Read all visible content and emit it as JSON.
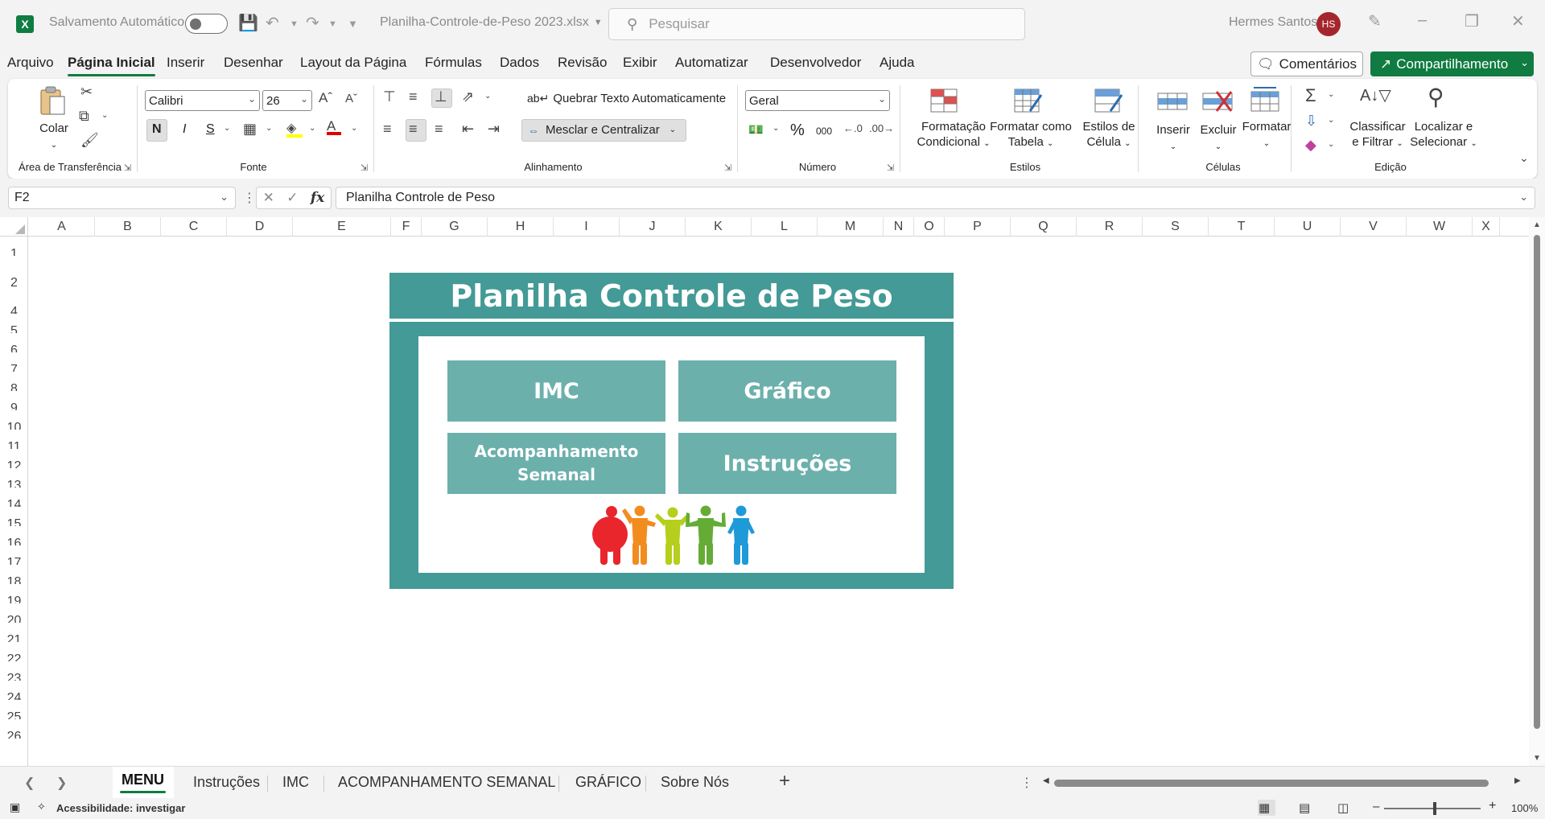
{
  "titlebar": {
    "autosave_label": "Salvamento Automático",
    "filename": "Planilha-Controle-de-Peso 2023.xlsx",
    "search_placeholder": "Pesquisar",
    "user_name": "Hermes Santos",
    "user_initials": "HS"
  },
  "menu": {
    "tabs": [
      "Arquivo",
      "Página Inicial",
      "Inserir",
      "Desenhar",
      "Layout da Página",
      "Fórmulas",
      "Dados",
      "Revisão",
      "Exibir",
      "Automatizar",
      "Desenvolvedor",
      "Ajuda"
    ],
    "active": "Página Inicial",
    "comments_label": "Comentários",
    "share_label": "Compartilhamento"
  },
  "ribbon": {
    "clipboard": {
      "paste_label": "Colar",
      "group_label": "Área de Transferência"
    },
    "font": {
      "font_name": "Calibri",
      "font_size": "26",
      "bold": "N",
      "italic": "I",
      "underline": "S",
      "group_label": "Fonte"
    },
    "alignment": {
      "wrap_label": "Quebrar Texto Automaticamente",
      "merge_label": "Mesclar e Centralizar",
      "group_label": "Alinhamento"
    },
    "number": {
      "format": "Geral",
      "percent": "%",
      "thousands": "000",
      "group_label": "Número"
    },
    "styles": {
      "cond_format_l1": "Formatação",
      "cond_format_l2": "Condicional",
      "table_l1": "Formatar como",
      "table_l2": "Tabela",
      "cell_l1": "Estilos de",
      "cell_l2": "Célula",
      "group_label": "Estilos"
    },
    "cells": {
      "insert": "Inserir",
      "delete": "Excluir",
      "format": "Formatar",
      "group_label": "Células"
    },
    "editing": {
      "sort_l1": "Classificar",
      "sort_l2": "e Filtrar",
      "find_l1": "Localizar e",
      "find_l2": "Selecionar",
      "group_label": "Edição"
    }
  },
  "formula_bar": {
    "name_box": "F2",
    "fx": "fx",
    "content": "Planilha Controle de Peso"
  },
  "grid": {
    "columns": [
      "A",
      "B",
      "C",
      "D",
      "E",
      "F",
      "G",
      "H",
      "I",
      "J",
      "K",
      "L",
      "M",
      "N",
      "O",
      "P",
      "Q",
      "R",
      "S",
      "T",
      "U",
      "V",
      "W",
      "X"
    ],
    "rows": [
      "1",
      "2",
      "4",
      "5",
      "6",
      "7",
      "8",
      "9",
      "10",
      "11",
      "12",
      "13",
      "14",
      "15",
      "16",
      "17",
      "18",
      "19",
      "20",
      "21",
      "22",
      "23",
      "24",
      "25",
      "26"
    ]
  },
  "menu_card": {
    "title": "Planilha Controle de Peso",
    "btn_imc": "IMC",
    "btn_grafico": "Gráfico",
    "btn_acomp_l1": "Acompanhamento",
    "btn_acomp_l2": "Semanal",
    "btn_instrucoes": "Instruções",
    "colors": {
      "frame": "#439a96",
      "button": "#6cb0ac"
    }
  },
  "sheet_tabs": {
    "tabs": [
      "MENU",
      "Instruções",
      "IMC",
      "ACOMPANHAMENTO SEMANAL",
      "GRÁFICO",
      "Sobre Nós"
    ],
    "active": "MENU"
  },
  "status": {
    "accessibility": "Acessibilidade: investigar",
    "zoom": "100%"
  }
}
